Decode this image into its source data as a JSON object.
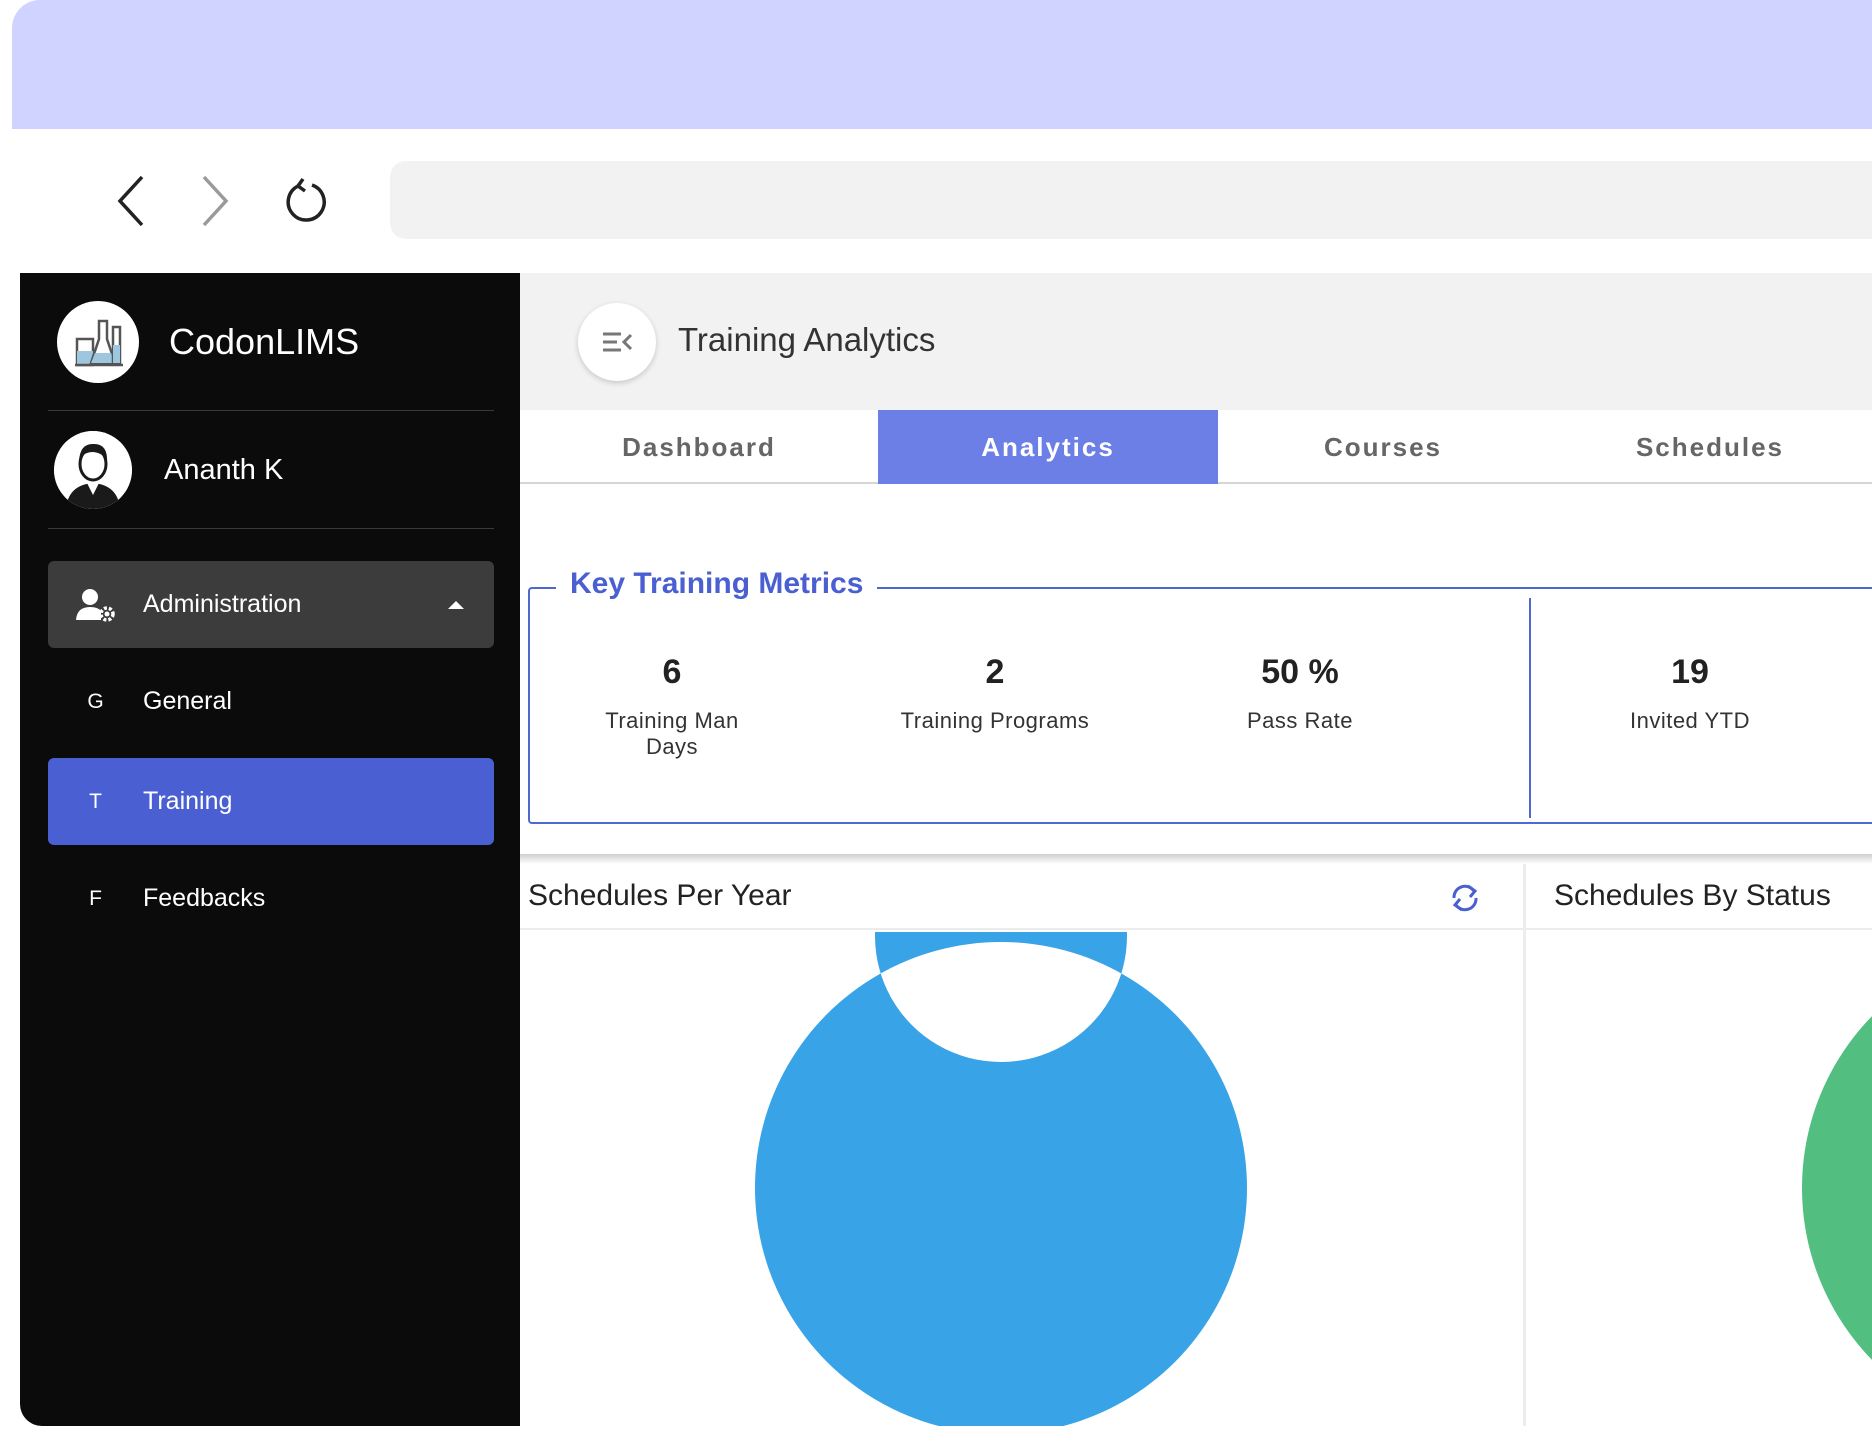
{
  "browser": {
    "back_icon": "chevron-left-icon",
    "forward_icon": "chevron-right-icon",
    "reload_icon": "reload-icon",
    "address": ""
  },
  "sidebar": {
    "brand": "CodonLIMS",
    "user": "Ananth K",
    "menu": {
      "admin_label": "Administration",
      "items": [
        {
          "letter": "G",
          "label": "General"
        },
        {
          "letter": "T",
          "label": "Training"
        },
        {
          "letter": "F",
          "label": "Feedbacks"
        }
      ]
    }
  },
  "header": {
    "title": "Training Analytics"
  },
  "tabs": [
    {
      "label": "Dashboard"
    },
    {
      "label": "Analytics"
    },
    {
      "label": "Courses"
    },
    {
      "label": "Schedules"
    }
  ],
  "metrics": {
    "legend": "Key Training Metrics",
    "items": [
      {
        "value": "6",
        "label": "Training Man Days"
      },
      {
        "value": "2",
        "label": "Training Programs"
      },
      {
        "value": "50 %",
        "label": "Pass Rate"
      },
      {
        "value": "19",
        "label": "Invited YTD"
      }
    ]
  },
  "cards": {
    "per_year_title": "Schedules Per Year",
    "by_status_title": "Schedules By Status"
  },
  "colors": {
    "accent": "#4a5fd1",
    "tab_active": "#6b7fe6",
    "donut_blue": "#39a3e8",
    "donut_green": "#52bf80",
    "sidebar_bg": "#0b0b0b",
    "titlebar": "#d0d3ff"
  },
  "chart_data": [
    {
      "type": "pie",
      "title": "Schedules Per Year",
      "categories": [
        ""
      ],
      "values": [
        100
      ],
      "colors": [
        "#39a3e8"
      ],
      "donut": true
    },
    {
      "type": "pie",
      "title": "Schedules By Status",
      "categories": [
        ""
      ],
      "values": [
        100
      ],
      "colors": [
        "#52bf80"
      ],
      "donut": true
    }
  ]
}
